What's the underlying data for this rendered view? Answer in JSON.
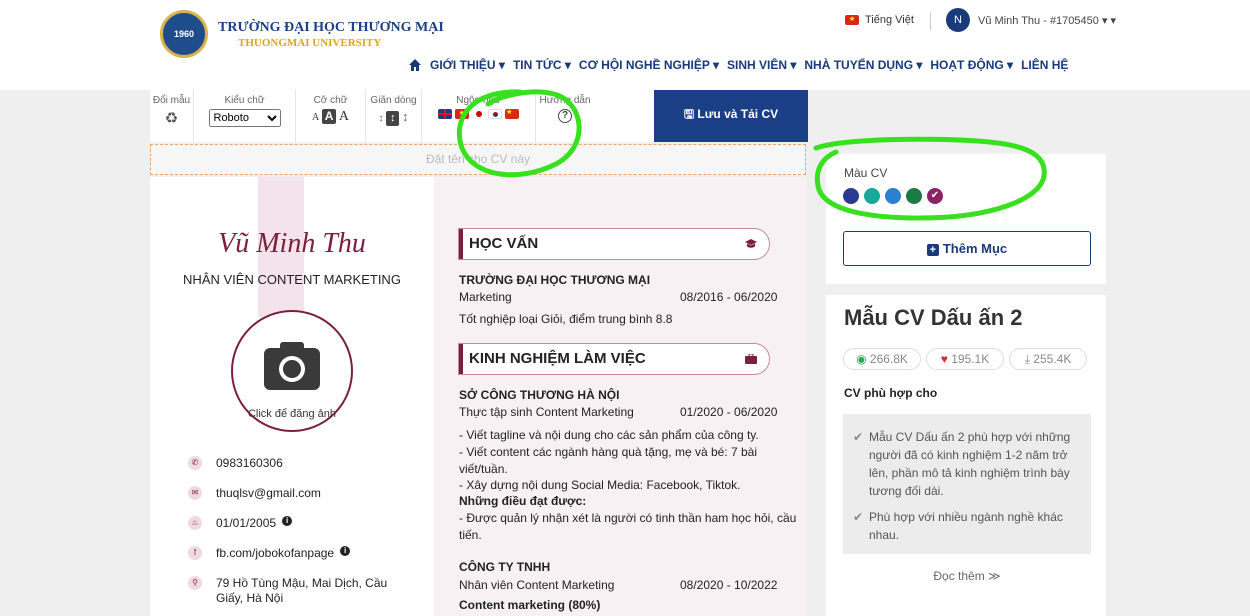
{
  "header": {
    "logo_text": "1960",
    "university_vn": "TRƯỜNG ĐẠI HỌC THƯƠNG MẠI",
    "university_en": "THUONGMAI UNIVERSITY",
    "language": "Tiếng Việt",
    "avatar_letter": "N",
    "user_label": "Vũ Minh Thu - #1705450 ▾ ▾"
  },
  "nav": {
    "items": [
      "GIỚI THIỆU ▾",
      "TIN TỨC ▾",
      "CƠ HỘI NGHỀ NGHIỆP ▾",
      "SINH VIÊN ▾",
      "NHÀ TUYỂN DỤNG ▾",
      "HOẠT ĐỘNG ▾",
      "LIÊN HỆ"
    ]
  },
  "toolbar": {
    "color_label": "Đổi mẫu",
    "font_label": "Kiểu chữ",
    "font_value": "Roboto",
    "size_label": "Cỡ chữ",
    "spacing_label": "Giãn dòng",
    "lang_label": "Ngôn ngữ",
    "guide_label": "Hướng dẫn",
    "save_label": "🖫 Lưu và Tải CV"
  },
  "cv": {
    "name_placeholder": "Đặt tên cho CV này",
    "name": "Vũ Minh Thu",
    "title": "NHÂN VIÊN CONTENT MARKETING",
    "photo_label": "Click để đăng ảnh",
    "contacts": [
      {
        "icon": "phone",
        "text": "0983160306"
      },
      {
        "icon": "email",
        "text": "thuqlsv@gmail.com"
      },
      {
        "icon": "cake",
        "text": "01/01/2005"
      },
      {
        "icon": "facebook",
        "text": "fb.com/jobokofanpage"
      },
      {
        "icon": "location",
        "text": "79 Hồ Tùng Mậu, Mai Dịch, Cầu Giấy, Hà Nội"
      }
    ],
    "education_heading": "HỌC VẤN",
    "edu_school": "TRƯỜNG ĐẠI HỌC THƯƠNG MẠI",
    "edu_major": "Marketing",
    "edu_date": "08/2016 - 06/2020",
    "edu_desc": "Tốt nghiệp loại Giỏi, điểm trung bình 8.8",
    "experience_heading": "KINH NGHIỆM LÀM VIỆC",
    "exp1_company": "SỞ CÔNG THƯƠNG HÀ NỘI",
    "exp1_role": "Thực tập sinh Content Marketing",
    "exp1_date": "01/2020 - 06/2020",
    "exp1_lines": [
      "- Viết tagline và nội dung cho các sản phẩm của công ty.",
      "- Viết content các ngành hàng quà tặng, mẹ và bé: 7 bài",
      "viết/tuần.",
      "- Xây dựng nội dung Social Media: Facebook, Tiktok."
    ],
    "exp1_achieve_head": "Những điều đạt được:",
    "exp1_achieve": [
      "- Được quản lý nhận xét là người có tinh thần ham học hỏi, cầu",
      "tiến."
    ],
    "exp2_company": "CÔNG TY TNHH",
    "exp2_role": "Nhân viên Content Marketing",
    "exp2_date": "08/2020 - 10/2022",
    "exp2_skill": "Content marketing (80%)"
  },
  "side": {
    "color_label": "Màu CV",
    "colors": [
      "#2a3b8f",
      "#16a89a",
      "#2d7fd0",
      "#1c7a46",
      "#8c2366"
    ],
    "add_section": "Thêm Mục",
    "template_title": "Mẫu CV Dấu ấn 2",
    "views": "266.8K",
    "likes": "195.1K",
    "downloads": "255.4K",
    "suitable_label": "CV phù hợp cho",
    "suitable_1": "Mẫu CV Dấu ấn 2 phù hợp với những người đã có kinh nghiệm 1-2 năm trở lên, phần mô tả kinh nghiệm trình bày tương đối dài.",
    "suitable_2": "Phù hợp với nhiều ngành nghề khác nhau.",
    "read_more": "Đọc thêm ≫"
  }
}
